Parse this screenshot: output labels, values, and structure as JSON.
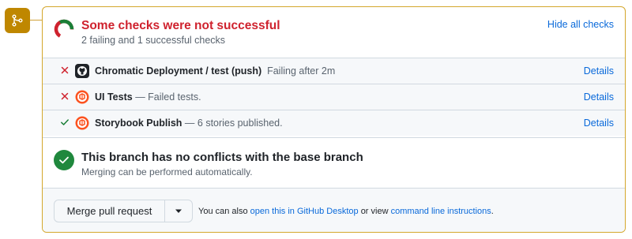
{
  "header": {
    "title": "Some checks were not successful",
    "subtitle": "2 failing and 1 successful checks",
    "hide_link": "Hide all checks",
    "status_colors": {
      "fail": "#cf222e",
      "success": "#1a7f37"
    }
  },
  "checks": [
    {
      "status": "fail",
      "icon": "github-icon",
      "name": "Chromatic Deployment / test (push)",
      "description": "Failing after 2m",
      "details_label": "Details"
    },
    {
      "status": "fail",
      "icon": "chromatic-icon",
      "name": "UI Tests",
      "description": "— Failed tests.",
      "details_label": "Details"
    },
    {
      "status": "success",
      "icon": "chromatic-icon",
      "name": "Storybook Publish",
      "description": "— 6 stories published.",
      "details_label": "Details"
    }
  ],
  "branch": {
    "title": "This branch has no conflicts with the base branch",
    "subtitle": "Merging can be performed automatically."
  },
  "merge": {
    "button_label": "Merge pull request",
    "note_prefix": "You can also",
    "desktop_link": "open this in GitHub Desktop",
    "note_middle": "or view",
    "cli_link": "command line instructions",
    "note_suffix": "."
  },
  "colors": {
    "accent": "#0969da",
    "warning_border": "#d4a72c",
    "merge_badge": "#bf8700"
  }
}
